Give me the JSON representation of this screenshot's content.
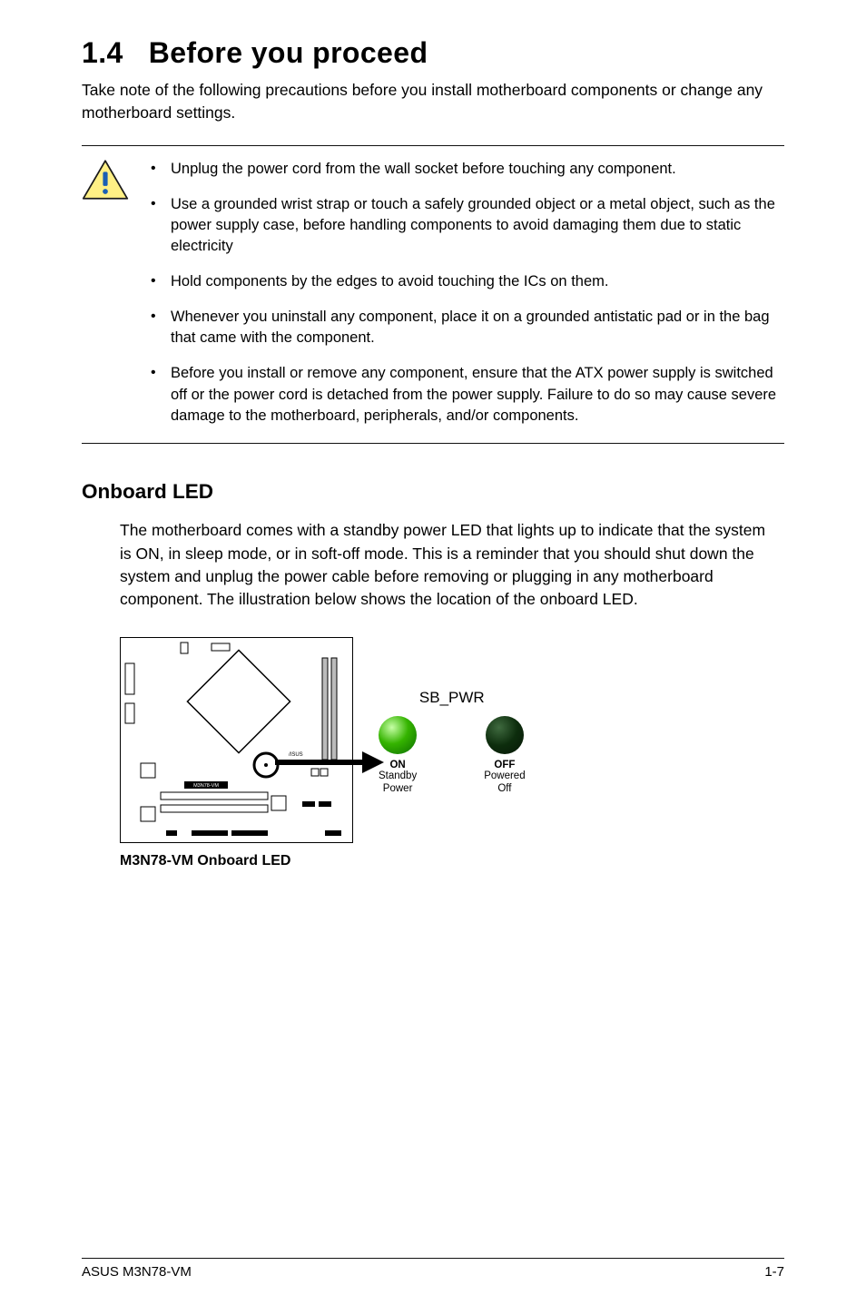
{
  "section": {
    "number": "1.4",
    "title": "Before you proceed"
  },
  "intro": "Take note of the following precautions before you install motherboard components or change any motherboard settings.",
  "warnings": [
    "Unplug the power cord from the wall socket before touching any component.",
    "Use a grounded wrist strap or touch a safely grounded object or a metal object, such as the power supply case, before handling components to avoid damaging them due to static electricity",
    "Hold components by the edges to avoid touching the ICs on them.",
    "Whenever you uninstall any component, place it on a grounded antistatic pad or in the bag that came with the component.",
    "Before you install or remove any component, ensure that the ATX power supply is switched off or the power cord is detached from the power supply. Failure to do so may cause severe damage to the motherboard, peripherals, and/or components."
  ],
  "onboard_led": {
    "heading": "Onboard LED",
    "body": "The motherboard comes with a standby power LED that lights up to indicate that the system is ON, in sleep mode, or in soft-off mode. This is a reminder that you should shut down the system and unplug the power cable before removing or plugging in any motherboard component. The illustration below shows the location of the onboard LED.",
    "signal_label": "SB_PWR",
    "diagram_label": "M3N78-VM",
    "on": {
      "state": "ON",
      "desc1": "Standby",
      "desc2": "Power"
    },
    "off": {
      "state": "OFF",
      "desc1": "Powered",
      "desc2": "Off"
    },
    "caption": "M3N78-VM Onboard LED"
  },
  "footer": {
    "left": "ASUS M3N78-VM",
    "right": "1-7"
  }
}
